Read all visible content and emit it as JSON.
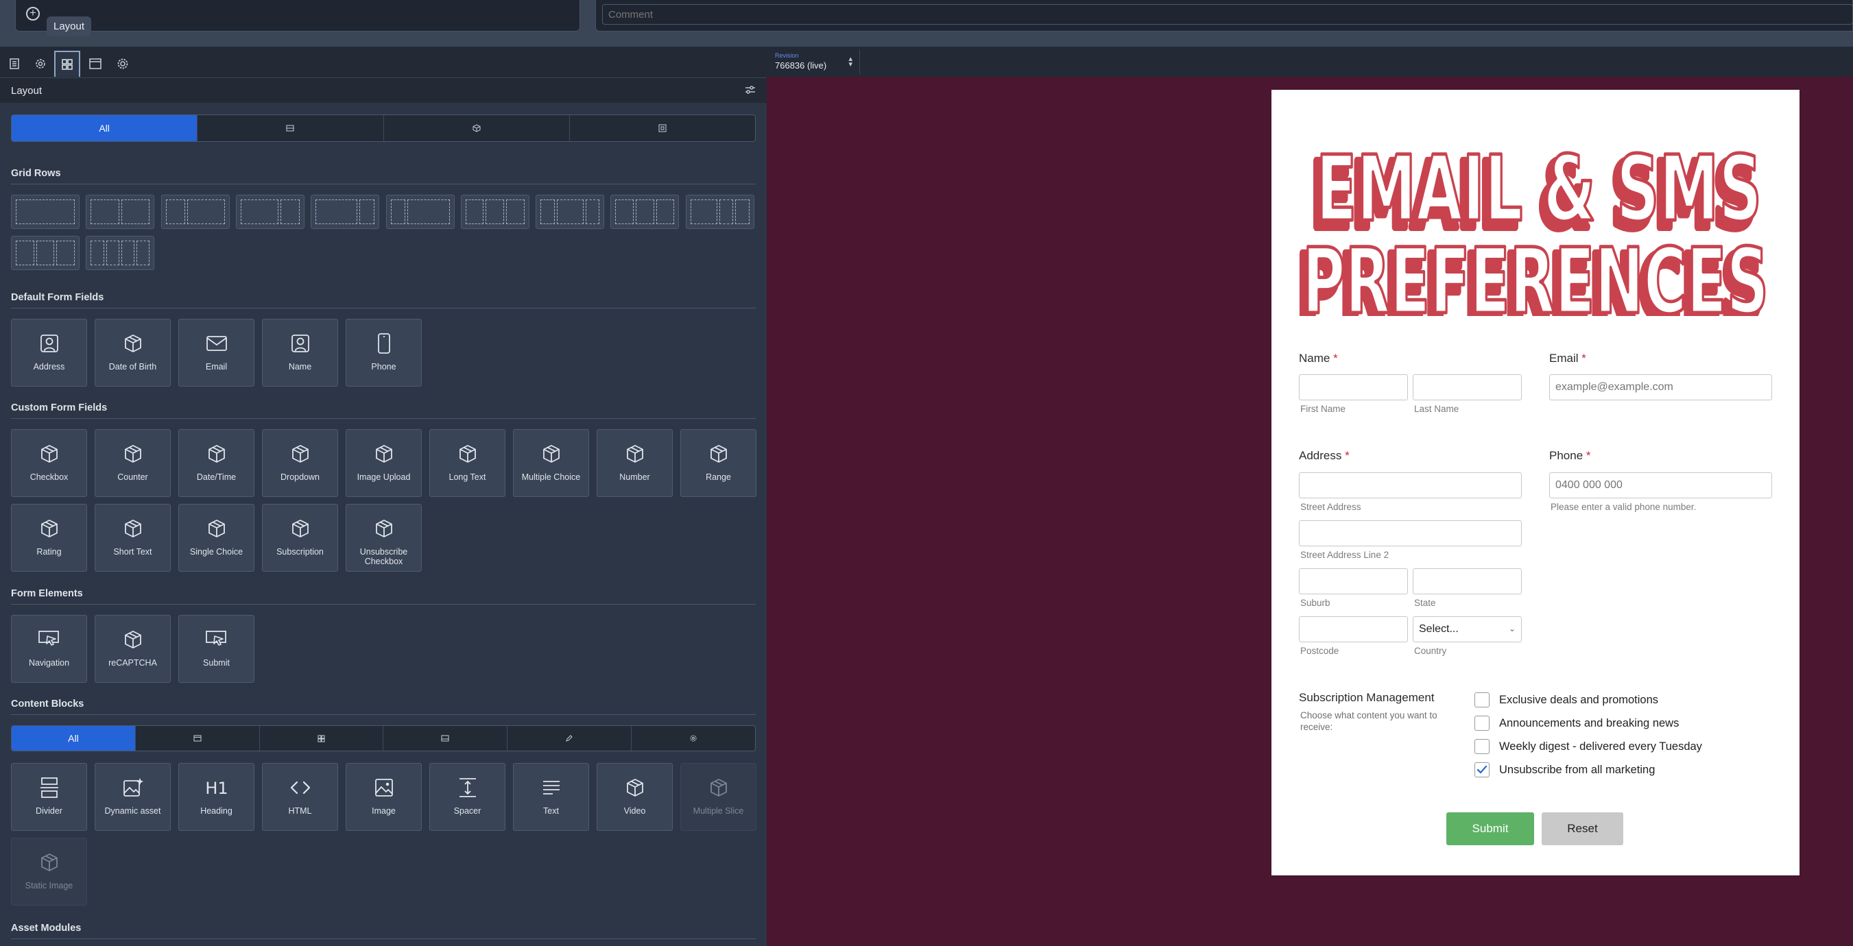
{
  "topbar": {
    "tooltip": "Layout",
    "comment_placeholder": "Comment",
    "add_icon": "plus-circle-icon"
  },
  "tool_tabs": [
    {
      "icon": "document-icon"
    },
    {
      "icon": "gear-icon"
    },
    {
      "icon": "grid-icon",
      "active": true
    },
    {
      "icon": "window-icon"
    },
    {
      "icon": "cog-icon"
    }
  ],
  "panel": {
    "title": "Layout",
    "filter_tabs": [
      "All",
      "",
      "",
      ""
    ],
    "sections": {
      "grid_rows": "Grid Rows",
      "default_fields": "Default Form Fields",
      "custom_fields": "Custom Form Fields",
      "form_elements": "Form Elements",
      "content_blocks": "Content Blocks",
      "asset_modules": "Asset Modules"
    },
    "default_fields": [
      "Address",
      "Date of Birth",
      "Email",
      "Name",
      "Phone"
    ],
    "custom_fields": [
      "Checkbox",
      "Counter",
      "Date/Time",
      "Dropdown",
      "Image Upload",
      "Long Text",
      "Multiple Choice",
      "Number",
      "Range",
      "Rating",
      "Short Text",
      "Single Choice",
      "Subscription",
      "Unsubscribe Checkbox"
    ],
    "form_elements": [
      "Navigation",
      "reCAPTCHA",
      "Submit"
    ],
    "content_tabs": [
      "All",
      "",
      "",
      "",
      "",
      ""
    ],
    "content_blocks": [
      "Divider",
      "Dynamic asset",
      "Heading",
      "HTML",
      "Image",
      "Spacer",
      "Text",
      "Video",
      "Multiple Slice",
      "Static Image"
    ]
  },
  "preview": {
    "revision_label": "Revision",
    "revision_value": "766836 (live)",
    "background_color": "#4a1630",
    "hero_line1": "EMAIL & SMS",
    "hero_line2": "PREFERENCES",
    "hero_color": "#c8434e",
    "form": {
      "name_label": "Name",
      "first_name_hint": "First Name",
      "last_name_hint": "Last Name",
      "email_label": "Email",
      "email_placeholder": "example@example.com",
      "address_label": "Address",
      "street_hint": "Street Address",
      "street2_hint": "Street Address Line 2",
      "suburb_hint": "Suburb",
      "state_hint": "State",
      "postcode_hint": "Postcode",
      "country_hint": "Country",
      "country_value": "Select...",
      "phone_label": "Phone",
      "phone_placeholder": "0400 000 000",
      "phone_hint": "Please enter a valid phone number.",
      "subscription_title": "Subscription Management",
      "subscription_desc": "Choose what content you want to receive:",
      "options": [
        {
          "label": "Exclusive deals and promotions",
          "checked": false
        },
        {
          "label": "Announcements and breaking news",
          "checked": false
        },
        {
          "label": "Weekly digest - delivered every Tuesday",
          "checked": false
        },
        {
          "label": "Unsubscribe from all marketing",
          "checked": true
        }
      ],
      "submit_label": "Submit",
      "reset_label": "Reset",
      "submit_color": "#5db266"
    }
  }
}
